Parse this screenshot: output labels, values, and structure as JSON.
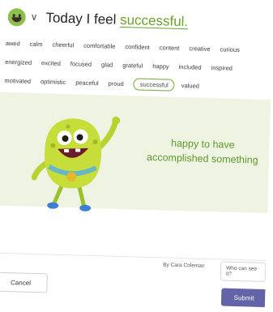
{
  "header": {
    "prefix": "Today I feel",
    "feeling": "successful."
  },
  "tags": [
    [
      "awed",
      "calm",
      "cheerful",
      "comfortable",
      "confident",
      "content",
      "creative",
      "curious"
    ],
    [
      "energized",
      "excited",
      "focused",
      "glad",
      "grateful",
      "happy",
      "included",
      "inspired"
    ],
    [
      "motivated",
      "optimistic",
      "peaceful",
      "proud",
      "successful",
      "valued"
    ]
  ],
  "selected_tag": "successful",
  "banner": {
    "line1": "happy to have",
    "line2": "accomplished something"
  },
  "footer": {
    "byline": "By Cara Coleman",
    "who_can_see": "Who can see it?"
  },
  "buttons": {
    "cancel": "Cancel",
    "submit": "Submit"
  },
  "icons": {
    "mood": "smiley-emoji-icon",
    "dropdown": "chevron-down-icon",
    "character": "green-monster-illustration"
  },
  "colors": {
    "accent": "#6aa32b",
    "banner_bg": "#eef3e2",
    "submit_bg": "#6264a7"
  }
}
